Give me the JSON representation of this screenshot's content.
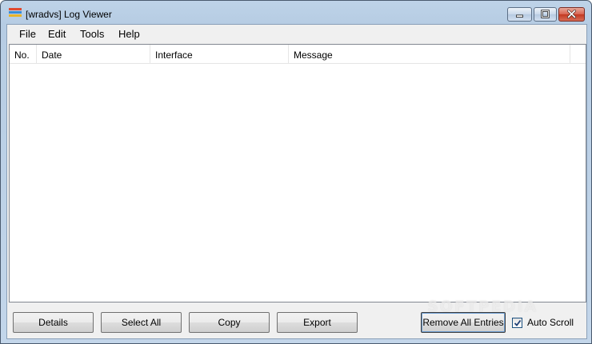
{
  "window": {
    "title": "[wradvs] Log Viewer"
  },
  "menu": {
    "items": [
      "File",
      "Edit",
      "Tools",
      "Help"
    ]
  },
  "table": {
    "columns": [
      "No.",
      "Date",
      "Interface",
      "Message"
    ],
    "rows": []
  },
  "buttons": {
    "details": "Details",
    "select_all": "Select All",
    "copy": "Copy",
    "export": "Export",
    "remove_all": "Remove All Entries"
  },
  "auto_scroll": {
    "label": "Auto Scroll",
    "checked": true
  },
  "watermark": "SOFTPEDIA",
  "icons": {
    "app": "log-viewer-app-icon",
    "min": "minimize-icon",
    "max": "maximize-icon",
    "close": "close-icon",
    "check": "checkmark-icon"
  },
  "colors": {
    "close_button": "#c23a22",
    "titlebar": "#bed3e8"
  }
}
